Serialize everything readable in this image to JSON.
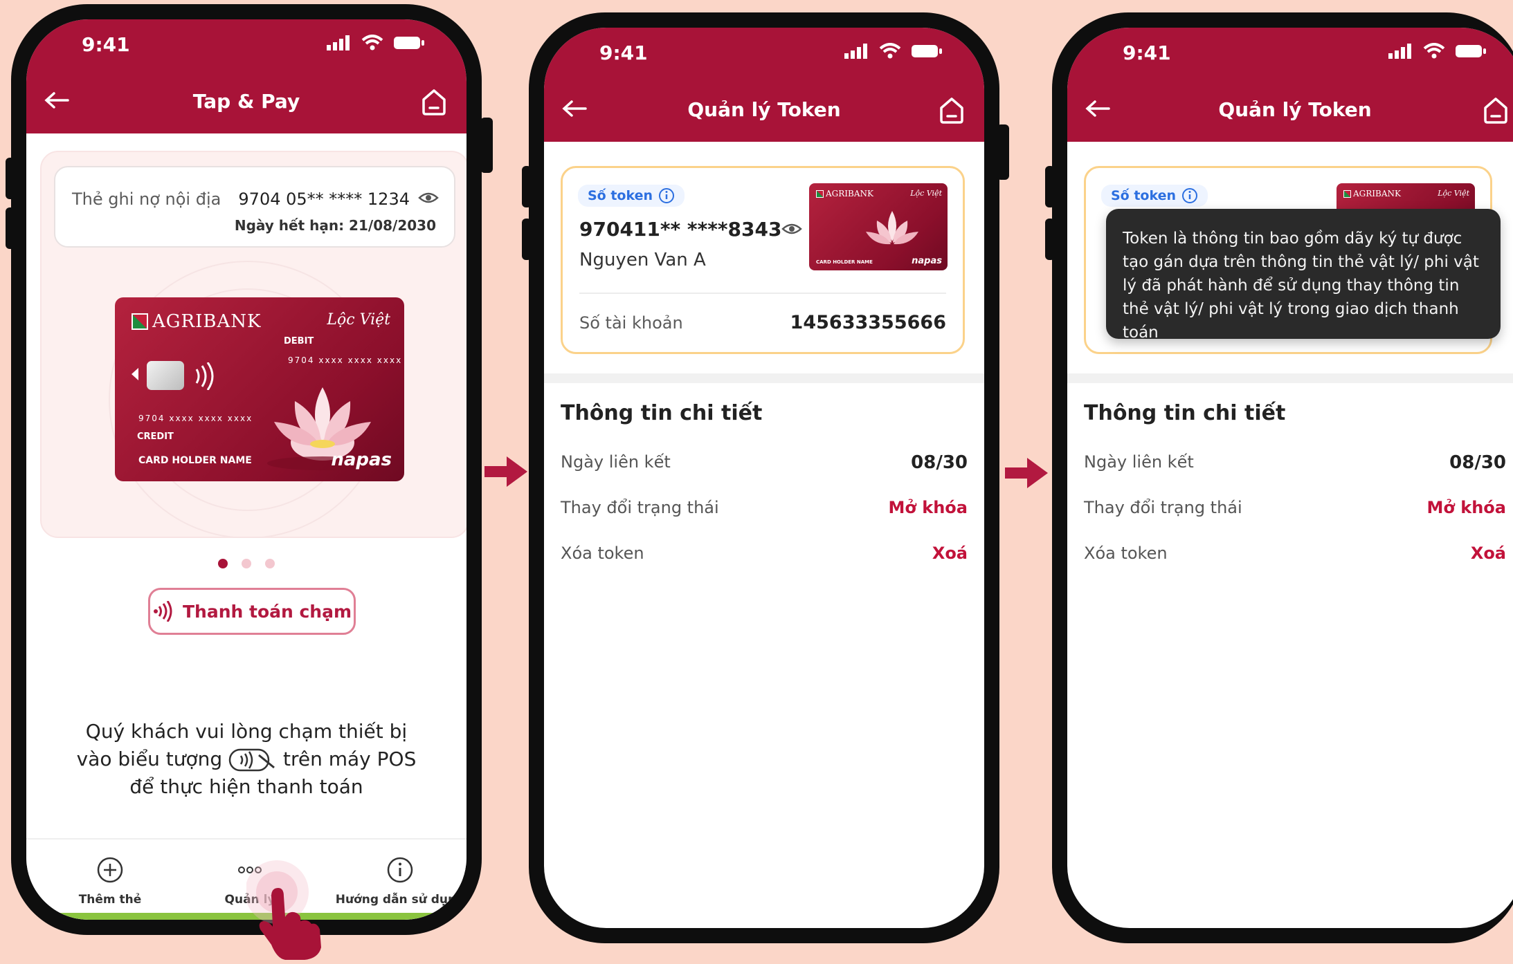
{
  "phone1": {
    "time": "9:41",
    "title": "Tap & Pay",
    "card_label": "Thẻ ghi nợ nội địa",
    "card_number": "9704 05** **** 1234",
    "expiry": "Ngày hết hạn: 21/08/2030",
    "card": {
      "bank": "AGRIBANK",
      "brand": "Lộc Việt",
      "debit": "DEBIT",
      "debit_number": "9704 xxxx xxxx xxxx",
      "credit_number": "9704 xxxx xxxx xxxx",
      "credit": "CREDIT",
      "holder": "CARD HOLDER NAME",
      "network": "napas"
    },
    "pay_button": "Thanh toán chạm",
    "instruction_line1": "Quý khách vui lòng chạm thiết bị",
    "instruction_line2_a": "vào biểu tượng",
    "instruction_line2_b": "trên máy POS",
    "instruction_line3": "để thực hiện thanh toán",
    "nav": [
      {
        "label": "Thêm thẻ",
        "icon": "plus-circle-icon"
      },
      {
        "label": "Quản lý",
        "icon": "more-dots-icon"
      },
      {
        "label": "Hướng dẫn sử dụng",
        "icon": "info-circle-icon"
      }
    ]
  },
  "phone2": {
    "time": "9:41",
    "title": "Quản lý Token",
    "token_badge": "Số token",
    "token_number": "970411** ****8343",
    "holder_name": "Nguyen Van A",
    "account_label": "Số tài khoản",
    "account_value": "145633355666",
    "section_title": "Thông tin chi tiết",
    "rows": [
      {
        "label": "Ngày liên kết",
        "value": "08/30"
      },
      {
        "label": "Thay đổi trạng thái",
        "value": "Mở khóa"
      },
      {
        "label": "Xóa token",
        "value": "Xoá"
      }
    ]
  },
  "phone3": {
    "time": "9:41",
    "title": "Quản lý Token",
    "token_badge": "Số token",
    "tooltip": "Token là thông tin bao gồm dãy ký tự được tạo gán dựa trên thông tin thẻ vật lý/ phi vật lý đã phát hành để sử dụng thay thông tin thẻ vật lý/ phi vật lý trong giao dịch thanh toán",
    "section_title": "Thông tin chi tiết",
    "rows": [
      {
        "label": "Ngày liên kết",
        "value": "08/30"
      },
      {
        "label": "Thay đổi trạng thái",
        "value": "Mở khóa"
      },
      {
        "label": "Xóa token",
        "value": "Xoá"
      }
    ]
  },
  "colors": {
    "brand": "#a81338",
    "background": "#fbd6c8",
    "accent_red": "#c2123a",
    "token_badge_blue": "#2c6fe0"
  }
}
